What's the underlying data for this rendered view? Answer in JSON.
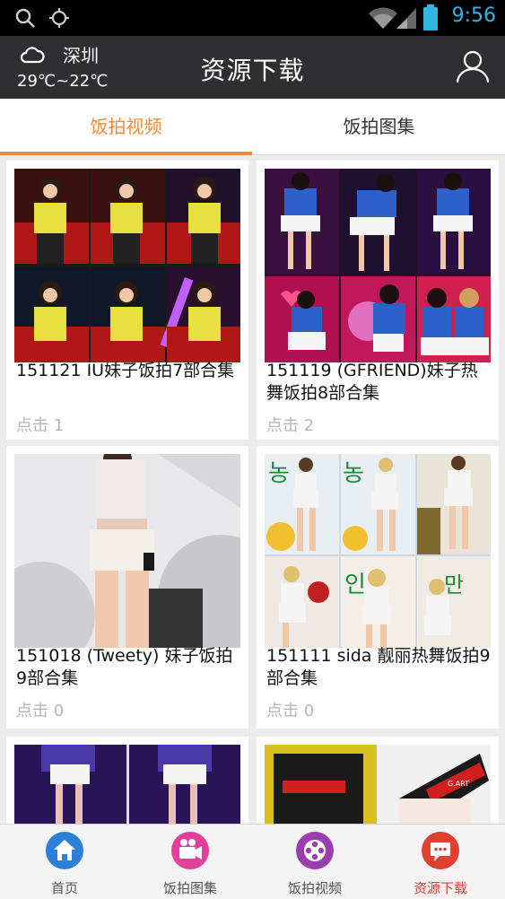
{
  "status_bar": {
    "time": "9:56"
  },
  "header": {
    "city": "深圳",
    "temperature": "29℃~22℃",
    "title": "资源下载"
  },
  "tabs": [
    {
      "label": "饭拍视频",
      "active": true
    },
    {
      "label": "饭拍图集",
      "active": false
    }
  ],
  "cards": [
    {
      "title": "151121 IU妹子饭拍7部合集",
      "clicks": "点击 1"
    },
    {
      "title": "151119 (GFRIEND)妹子热舞饭拍8部合集",
      "clicks": "点击 2"
    },
    {
      "title": "151018 (Tweety) 妹子饭拍9部合集",
      "clicks": "点击 0"
    },
    {
      "title": "151111 sida 靓丽热舞饭拍9部合集",
      "clicks": "点击 0"
    },
    {
      "title": "",
      "clicks": ""
    },
    {
      "title": "",
      "clicks": ""
    }
  ],
  "bottom_nav": [
    {
      "label": "首页",
      "icon": "home-icon",
      "color": "#2d7fd8"
    },
    {
      "label": "饭拍图集",
      "icon": "camera-icon",
      "color": "#e0409a"
    },
    {
      "label": "饭拍视频",
      "icon": "film-reel-icon",
      "color": "#9b3fb0"
    },
    {
      "label": "资源下载",
      "icon": "chat-bubble-icon",
      "color": "#e0402f",
      "active": true
    }
  ],
  "colors": {
    "accent": "#f0883a",
    "header_bg": "#2f2f31",
    "active_nav": "#e0402f"
  }
}
